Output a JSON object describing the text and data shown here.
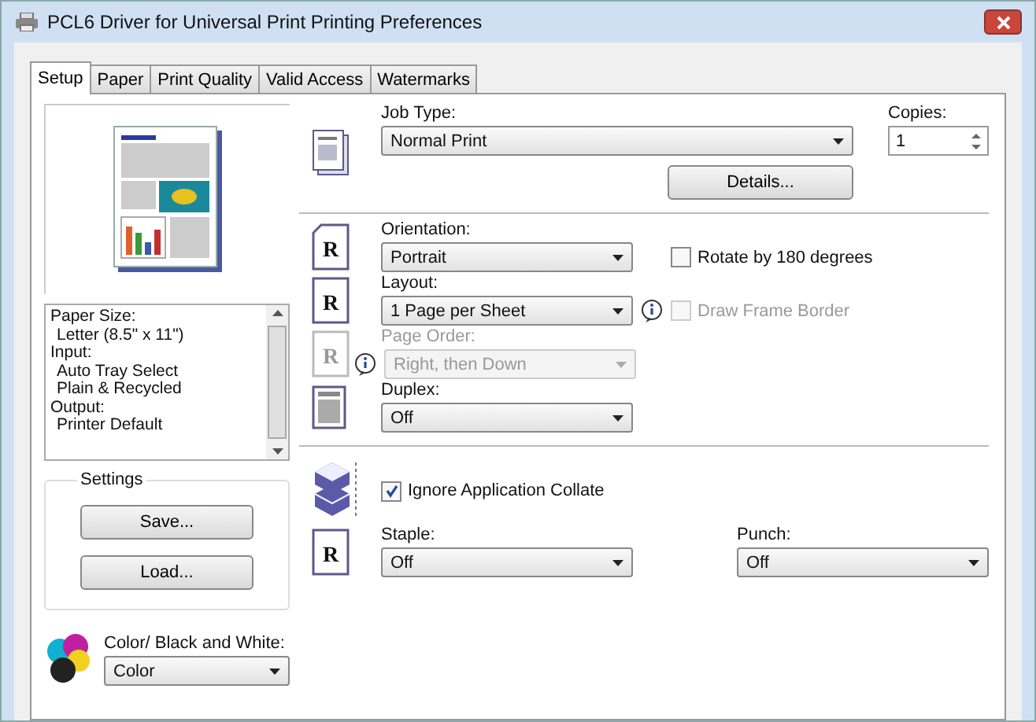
{
  "window": {
    "title": "PCL6 Driver for Universal Print Printing Preferences"
  },
  "tabs": [
    {
      "label": "Setup",
      "selected": true
    },
    {
      "label": "Paper",
      "selected": false
    },
    {
      "label": "Print Quality",
      "selected": false
    },
    {
      "label": "Valid Access",
      "selected": false
    },
    {
      "label": "Watermarks",
      "selected": false
    }
  ],
  "summary": {
    "lines": [
      {
        "text": "Paper Size:",
        "kind": "heading"
      },
      {
        "text": "Letter (8.5\" x 11\")",
        "kind": "value"
      },
      {
        "text": "Input:",
        "kind": "heading"
      },
      {
        "text": "Auto Tray Select",
        "kind": "value"
      },
      {
        "text": "Plain & Recycled",
        "kind": "value"
      },
      {
        "text": "Output:",
        "kind": "heading"
      },
      {
        "text": "Printer Default",
        "kind": "value"
      }
    ]
  },
  "settings": {
    "title": "Settings",
    "buttons": [
      "Save...",
      "Load..."
    ]
  },
  "color_mode": {
    "label": "Color/ Black and White:",
    "value": "Color"
  },
  "job_type": {
    "label": "Job Type:",
    "value": "Normal Print",
    "details_button": "Details..."
  },
  "copies": {
    "label": "Copies:",
    "value": "1"
  },
  "orientation": {
    "label": "Orientation:",
    "value": "Portrait",
    "icon_letter": "R",
    "rotate": {
      "label": "Rotate by 180 degrees",
      "checked": false
    }
  },
  "layout": {
    "label": "Layout:",
    "value": "1 Page per Sheet",
    "icon_letter": "R",
    "frame_border": {
      "label": "Draw Frame Border",
      "checked": false,
      "disabled": true
    }
  },
  "page_order": {
    "label": "Page Order:",
    "value": "Right, then Down",
    "icon_letter": "R",
    "disabled": true
  },
  "duplex": {
    "label": "Duplex:",
    "value": "Off"
  },
  "collate": {
    "label": "Ignore Application Collate",
    "checked": true
  },
  "staple": {
    "label": "Staple:",
    "value": "Off",
    "icon_letter": "R"
  },
  "punch": {
    "label": "Punch:",
    "value": "Off"
  }
}
